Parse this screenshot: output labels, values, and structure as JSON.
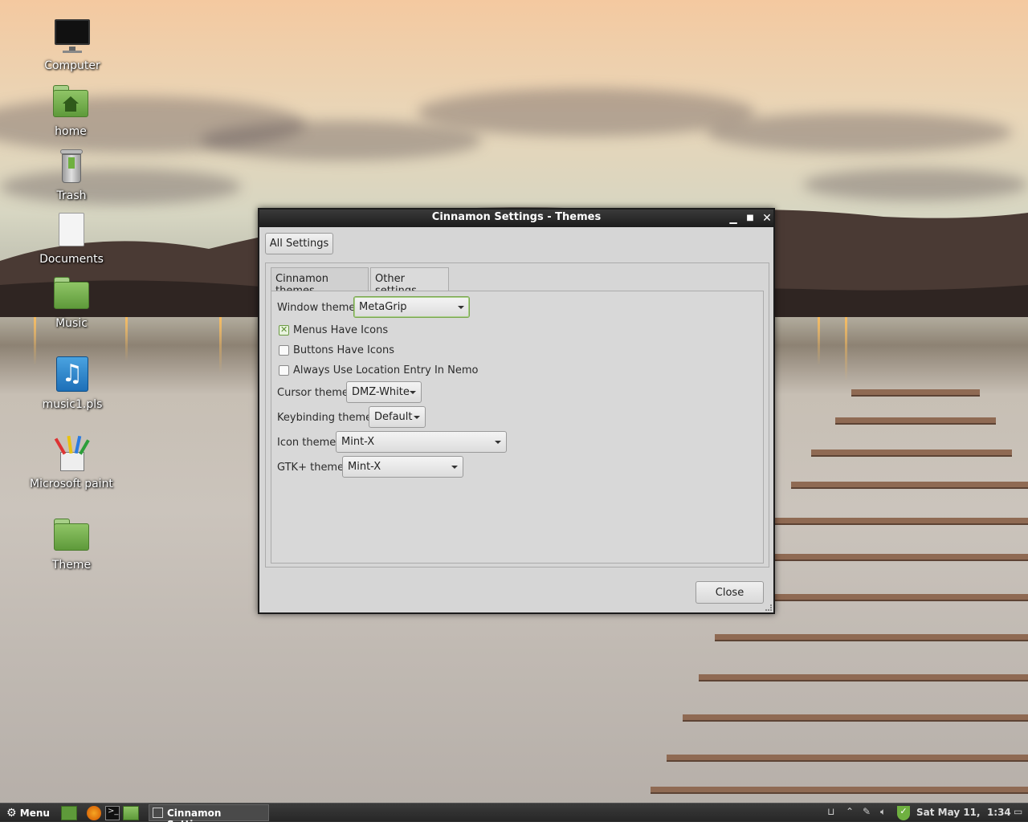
{
  "desktop": {
    "icons": [
      {
        "label": "Computer",
        "icon": "monitor-icon"
      },
      {
        "label": "home",
        "icon": "home-folder-icon"
      },
      {
        "label": "Trash",
        "icon": "trash-icon"
      },
      {
        "label": "Documents",
        "icon": "document-icon"
      },
      {
        "label": "Music",
        "icon": "folder-icon"
      },
      {
        "label": "music1.pls",
        "icon": "music-file-icon"
      },
      {
        "label": "Microsoft paint",
        "icon": "paint-icon"
      },
      {
        "label": "Theme",
        "icon": "folder-icon"
      }
    ]
  },
  "window": {
    "title": "Cinnamon Settings - Themes",
    "all_settings_label": "All Settings",
    "tabs": [
      {
        "label": "Cinnamon themes",
        "active": false
      },
      {
        "label": "Other settings",
        "active": true
      }
    ],
    "window_theme": {
      "label": "Window theme",
      "value": "MetaGrip"
    },
    "checkboxes": [
      {
        "label": "Menus Have Icons",
        "checked": true
      },
      {
        "label": "Buttons Have Icons",
        "checked": false
      },
      {
        "label": "Always Use Location Entry In Nemo",
        "checked": false
      }
    ],
    "cursor_theme": {
      "label": "Cursor theme",
      "value": "DMZ-White"
    },
    "keybinding_theme": {
      "label": "Keybinding theme",
      "value": "Default"
    },
    "icon_theme": {
      "label": "Icon theme",
      "value": "Mint-X"
    },
    "gtk_theme": {
      "label": "GTK+ theme",
      "value": "Mint-X"
    },
    "close_label": "Close"
  },
  "taskbar": {
    "menu_label": "Menu",
    "task_label": "Cinnamon Setting...",
    "clock": "Sat May 11,  1:34"
  },
  "colors": {
    "accent_green": "#7aa64f",
    "titlebar": "#1c1c1c",
    "window_bg": "#d6d6d6"
  }
}
